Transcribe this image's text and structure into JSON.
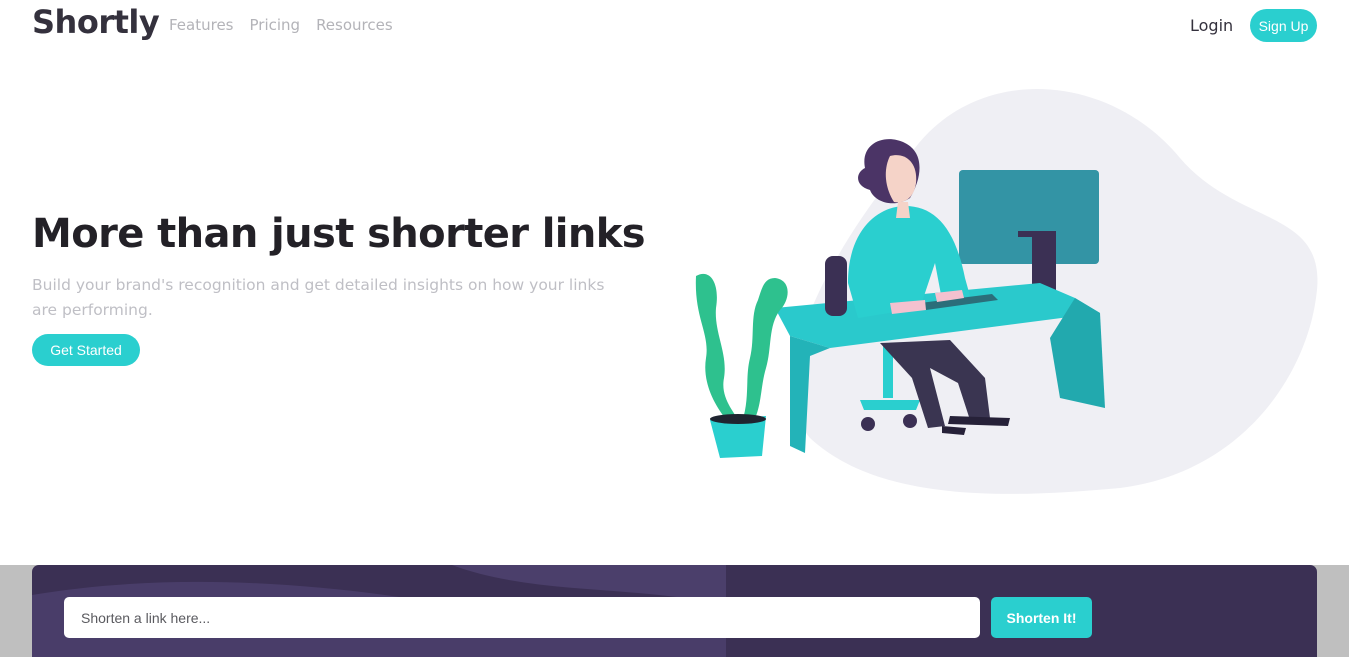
{
  "header": {
    "logo": "Shortly",
    "nav": [
      "Features",
      "Pricing",
      "Resources"
    ],
    "login_label": "Login",
    "signup_label": "Sign Up"
  },
  "hero": {
    "title": "More than just shorter links",
    "subtitle": "Build your brand's recognition and get detailed insights on how your links are performing.",
    "cta_label": "Get Started",
    "illustration": "person-working-at-desk-illustration"
  },
  "shorten": {
    "placeholder": "Shorten a link here...",
    "button_label": "Shorten It!"
  },
  "colors": {
    "accent": "#2acfcf",
    "dark_violet": "#3b3054",
    "heading": "#232127",
    "muted": "#bfbfc5"
  }
}
